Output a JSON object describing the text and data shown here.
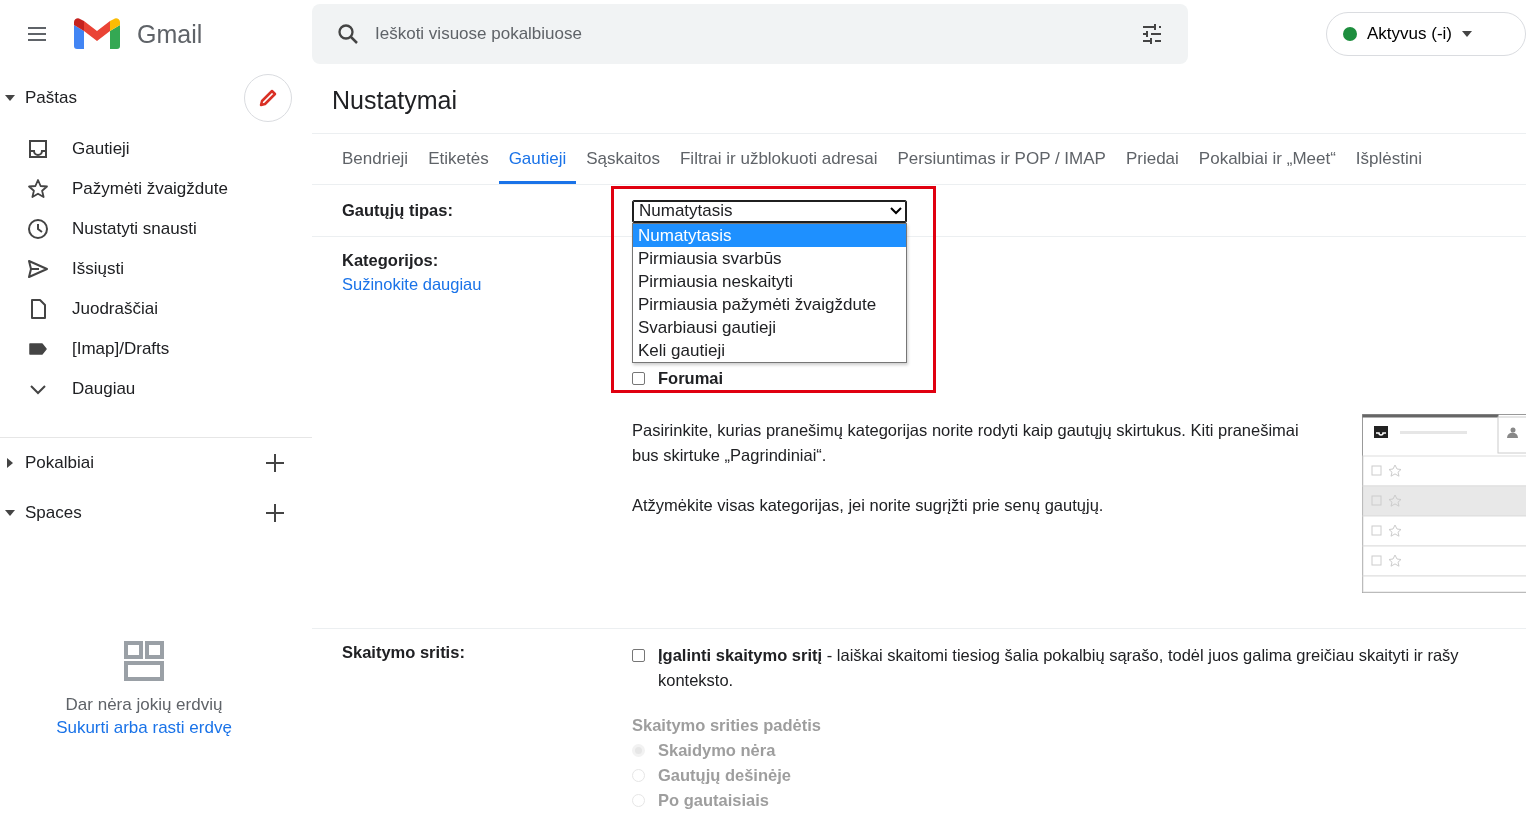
{
  "header": {
    "logo_text": "Gmail"
  },
  "search": {
    "placeholder": "Ieškoti visuose pokalbiuose"
  },
  "status": {
    "label": "Aktyvus (-i)"
  },
  "sidebar": {
    "mail_section": {
      "label": "Paštas",
      "expanded": true
    },
    "items": [
      {
        "label": "Gautieji",
        "selected": false
      },
      {
        "label": "Pažymėti žvaigždute",
        "selected": false
      },
      {
        "label": "Nustatyti snausti",
        "selected": false
      },
      {
        "label": "Išsiųsti",
        "selected": false
      },
      {
        "label": "Juodraščiai",
        "selected": false
      },
      {
        "label": "[Imap]/Drafts",
        "selected": false
      },
      {
        "label": "Daugiau",
        "selected": false
      }
    ],
    "sections": [
      {
        "label": "Pokalbiai",
        "expanded": false
      },
      {
        "label": "Spaces",
        "expanded": true
      }
    ],
    "spaces_empty": {
      "message": "Dar nėra jokių erdvių",
      "link": "Sukurti arba rasti erdvę"
    }
  },
  "page_title": "Nustatymai",
  "tabs": [
    {
      "label": "Bendrieji",
      "selected": false
    },
    {
      "label": "Etiketės",
      "selected": false
    },
    {
      "label": "Gautieji",
      "selected": true
    },
    {
      "label": "Sąskaitos",
      "selected": false
    },
    {
      "label": "Filtrai ir užblokuoti adresai",
      "selected": false
    },
    {
      "label": "Persiuntimas ir POP / IMAP",
      "selected": false
    },
    {
      "label": "Priedai",
      "selected": false
    },
    {
      "label": "Pokalbiai ir „Meet“",
      "selected": false
    },
    {
      "label": "Išplėstini",
      "selected": false
    }
  ],
  "settings": {
    "inbox_type": {
      "label": "Gautųjų tipas:",
      "value": "Numatytasis",
      "expanded": true,
      "options": [
        {
          "label": "Numatytasis",
          "selected": true
        },
        {
          "label": "Pirmiausia svarbūs",
          "selected": false
        },
        {
          "label": "Pirmiausia neskaityti",
          "selected": false
        },
        {
          "label": "Pirmiausia pažymėti žvaigždute",
          "selected": false
        },
        {
          "label": "Svarbiausi gautieji",
          "selected": false
        },
        {
          "label": "Keli gautieji",
          "selected": false
        }
      ]
    },
    "categories": {
      "label": "Kategorijos:",
      "link": "Sužinokite daugiau",
      "checkboxes": [
        {
          "label": "Forumai",
          "checked": false
        }
      ],
      "paragraphs": [
        "Pasirinkite, kurias pranešimų kategorijas norite rodyti kaip gautųjų skirtukus. Kiti pranešimai bus skirtuke „Pagrindiniai“.",
        "Atžymėkite visas kategorijas, jei norite sugrįžti prie senų gautųjų."
      ]
    },
    "reading_pane": {
      "label": "Skaitymo sritis:",
      "checked": false,
      "lines": [
        "**Įgalinti skaitymo sritį** - laiškai skaitomi tiesiog šalia pokalbių sąrašo, todėl juos galima greičiau skaityti ir rašy",
        "konteksto."
      ],
      "position": {
        "label": "Skaitymo srities padėtis",
        "disabled": true,
        "options": [
          {
            "label": "Skaidymo nėra",
            "selected": true
          },
          {
            "label": "Gautųjų dešinėje",
            "selected": false
          },
          {
            "label": "Po gautaisiais",
            "selected": false
          }
        ]
      }
    }
  }
}
